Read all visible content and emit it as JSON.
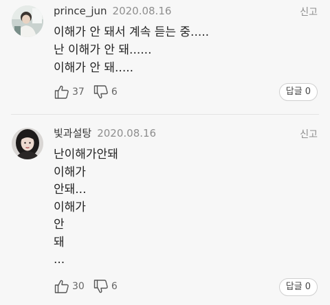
{
  "comments": [
    {
      "username": "prince_jun",
      "date": "2020.08.16",
      "report_label": "신고",
      "lines": [
        "이해가 안 돼서 계속 듣는 중.....",
        "난 이해가 안 돼......",
        "이해가 안 돼....."
      ],
      "likes": "37",
      "dislikes": "6",
      "reply_label": "답글",
      "reply_count": "0"
    },
    {
      "username": "빛과설탕",
      "date": "2020.08.16",
      "report_label": "신고",
      "lines": [
        "난이해가안돼",
        "이해가",
        "안돼...",
        "이해가",
        "안",
        "돼",
        "..."
      ],
      "likes": "30",
      "dislikes": "6",
      "reply_label": "답글",
      "reply_count": "0"
    }
  ],
  "icons": {
    "like": "thumbs-up-icon",
    "dislike": "thumbs-down-icon"
  },
  "colors": {
    "background": "#f7f7f7",
    "text_primary": "#222222",
    "text_secondary": "#8e8e8e",
    "border": "#cfcfcf"
  }
}
